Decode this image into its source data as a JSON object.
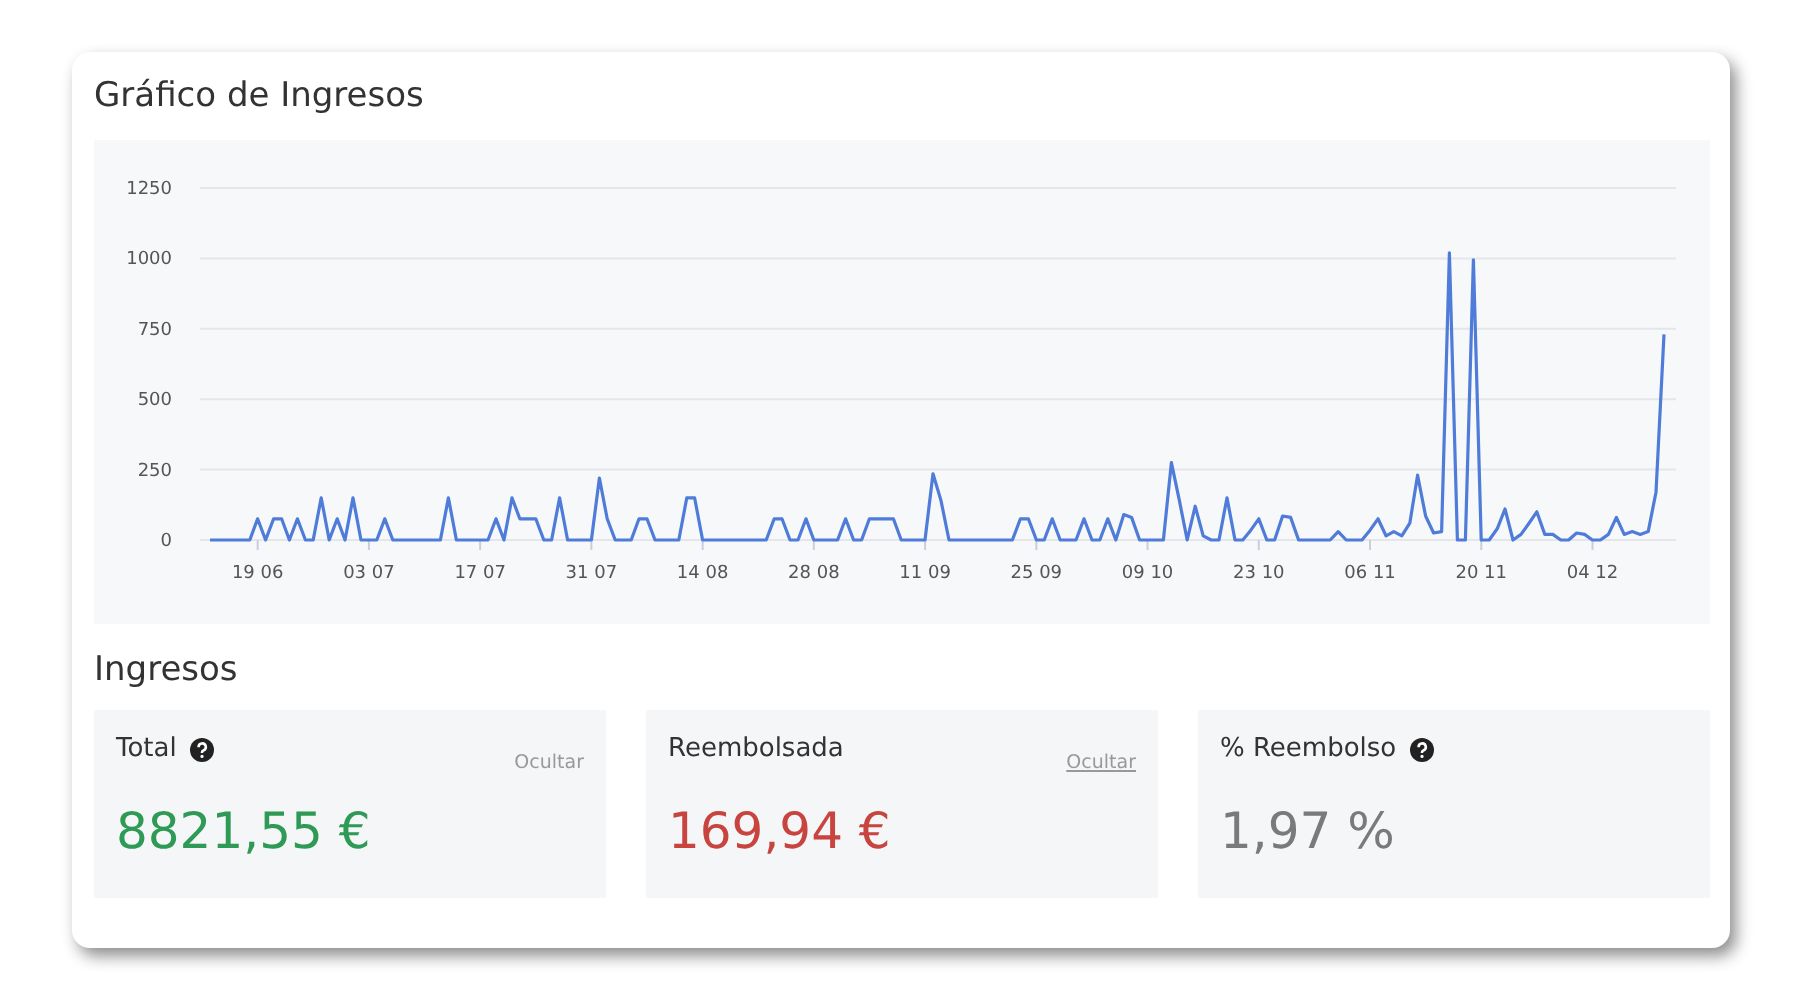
{
  "revenue_chart": {
    "title": "Gráfico de Ingresos",
    "chart_data": {
      "type": "line",
      "grid": true,
      "ylim": [
        0,
        1250
      ],
      "yticks": [
        0,
        250,
        500,
        750,
        1000,
        1250
      ],
      "categories": [
        null,
        null,
        null,
        null,
        null,
        null,
        "19 06",
        null,
        null,
        null,
        null,
        null,
        null,
        null,
        null,
        null,
        null,
        null,
        null,
        null,
        "03 07",
        null,
        null,
        null,
        null,
        null,
        null,
        null,
        null,
        null,
        null,
        null,
        null,
        null,
        "17 07",
        null,
        null,
        null,
        null,
        null,
        null,
        null,
        null,
        null,
        null,
        null,
        null,
        null,
        "31 07",
        null,
        null,
        null,
        null,
        null,
        null,
        null,
        null,
        null,
        null,
        null,
        null,
        null,
        "14 08",
        null,
        null,
        null,
        null,
        null,
        null,
        null,
        null,
        null,
        null,
        null,
        null,
        null,
        "28 08",
        null,
        null,
        null,
        null,
        null,
        null,
        null,
        null,
        null,
        null,
        null,
        null,
        null,
        "11 09",
        null,
        null,
        null,
        null,
        null,
        null,
        null,
        null,
        null,
        null,
        null,
        null,
        null,
        "25 09",
        null,
        null,
        null,
        null,
        null,
        null,
        null,
        null,
        null,
        null,
        null,
        null,
        null,
        "09 10",
        null,
        null,
        null,
        null,
        null,
        null,
        null,
        null,
        null,
        null,
        null,
        null,
        null,
        "23 10",
        null,
        null,
        null,
        null,
        null,
        null,
        null,
        null,
        null,
        null,
        null,
        null,
        null,
        "06 11",
        null,
        null,
        null,
        null,
        null,
        null,
        null,
        null,
        null,
        null,
        null,
        null,
        null,
        "20 11",
        null,
        null,
        null,
        null,
        null,
        null,
        null,
        null,
        null,
        null,
        null,
        null,
        null,
        "04 12",
        null,
        null,
        null,
        null,
        null,
        null,
        null,
        null,
        null
      ],
      "series": [
        {
          "color": "#4f7bd9",
          "values": [
            0,
            0,
            0,
            0,
            0,
            0,
            75,
            0,
            75,
            75,
            0,
            75,
            0,
            0,
            150,
            0,
            75,
            0,
            150,
            0,
            0,
            0,
            75,
            0,
            0,
            0,
            0,
            0,
            0,
            0,
            150,
            0,
            0,
            0,
            0,
            0,
            75,
            0,
            150,
            75,
            75,
            75,
            0,
            0,
            150,
            0,
            0,
            0,
            0,
            220,
            75,
            0,
            0,
            0,
            75,
            75,
            0,
            0,
            0,
            0,
            150,
            150,
            0,
            0,
            0,
            0,
            0,
            0,
            0,
            0,
            0,
            75,
            75,
            0,
            0,
            75,
            0,
            0,
            0,
            0,
            75,
            0,
            0,
            75,
            75,
            75,
            75,
            0,
            0,
            0,
            0,
            235,
            140,
            0,
            0,
            0,
            0,
            0,
            0,
            0,
            0,
            0,
            75,
            75,
            0,
            0,
            75,
            0,
            0,
            0,
            75,
            0,
            0,
            75,
            0,
            90,
            80,
            0,
            0,
            0,
            0,
            275,
            140,
            0,
            120,
            15,
            0,
            0,
            150,
            0,
            0,
            35,
            75,
            0,
            0,
            85,
            80,
            0,
            0,
            0,
            0,
            0,
            30,
            0,
            0,
            0,
            35,
            75,
            15,
            30,
            15,
            60,
            230,
            85,
            25,
            30,
            1020,
            0,
            0,
            995,
            0,
            0,
            40,
            110,
            0,
            20,
            60,
            100,
            20,
            20,
            0,
            0,
            25,
            20,
            0,
            0,
            20,
            80,
            20,
            30,
            20,
            30,
            170,
            730
          ]
        }
      ]
    }
  },
  "revenue": {
    "title": "Ingresos",
    "stats": [
      {
        "label": "Total",
        "help": true,
        "action": "Ocultar",
        "underlined": false,
        "value": "8821,55 €",
        "color": "#2f9a55"
      },
      {
        "label": "Reembolsada",
        "help": false,
        "action": "Ocultar",
        "underlined": true,
        "value": "169,94 €",
        "color": "#c8443f"
      },
      {
        "label": "% Reembolso",
        "help": true,
        "value": "1,97 %",
        "color": "#7a7a7a"
      }
    ]
  }
}
